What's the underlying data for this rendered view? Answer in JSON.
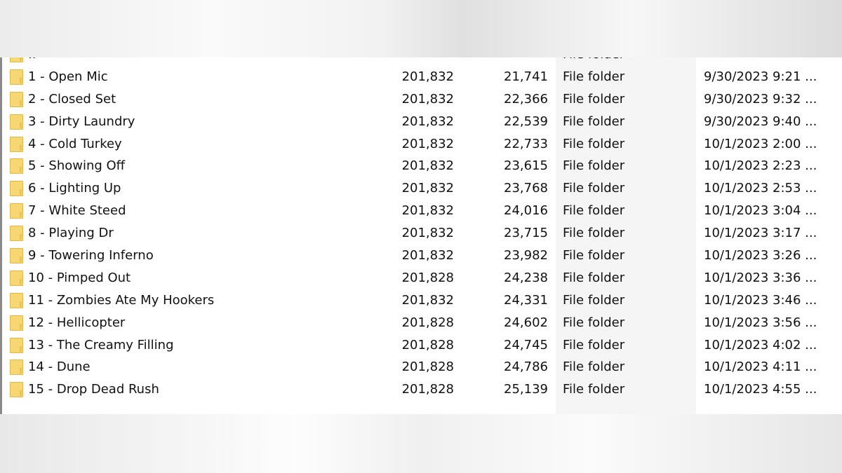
{
  "parent_row": {
    "name": "..",
    "type": "File folder"
  },
  "rows": [
    {
      "name": "1 - Open Mic",
      "c1": "201,832",
      "c2": "21,741",
      "type": "File folder",
      "date": "9/30/2023 9:21 ..."
    },
    {
      "name": "2 - Closed Set",
      "c1": "201,832",
      "c2": "22,366",
      "type": "File folder",
      "date": "9/30/2023 9:32 ..."
    },
    {
      "name": "3 - Dirty Laundry",
      "c1": "201,832",
      "c2": "22,539",
      "type": "File folder",
      "date": "9/30/2023 9:40 ..."
    },
    {
      "name": "4 - Cold Turkey",
      "c1": "201,832",
      "c2": "22,733",
      "type": "File folder",
      "date": "10/1/2023 2:00 ..."
    },
    {
      "name": "5 - Showing Off",
      "c1": "201,832",
      "c2": "23,615",
      "type": "File folder",
      "date": "10/1/2023 2:23 ..."
    },
    {
      "name": "6 - Lighting Up",
      "c1": "201,832",
      "c2": "23,768",
      "type": "File folder",
      "date": "10/1/2023 2:53 ..."
    },
    {
      "name": "7 - White Steed",
      "c1": "201,832",
      "c2": "24,016",
      "type": "File folder",
      "date": "10/1/2023 3:04 ..."
    },
    {
      "name": "8 - Playing Dr",
      "c1": "201,832",
      "c2": "23,715",
      "type": "File folder",
      "date": "10/1/2023 3:17 ..."
    },
    {
      "name": "9 - Towering Inferno",
      "c1": "201,832",
      "c2": "23,982",
      "type": "File folder",
      "date": "10/1/2023 3:26 ..."
    },
    {
      "name": "10 - Pimped Out",
      "c1": "201,828",
      "c2": "24,238",
      "type": "File folder",
      "date": "10/1/2023 3:36 ..."
    },
    {
      "name": "11 - Zombies Ate My Hookers",
      "c1": "201,832",
      "c2": "24,331",
      "type": "File folder",
      "date": "10/1/2023 3:46 ..."
    },
    {
      "name": "12 - Hellicopter",
      "c1": "201,828",
      "c2": "24,602",
      "type": "File folder",
      "date": "10/1/2023 3:56 ..."
    },
    {
      "name": "13 - The Creamy Filling",
      "c1": "201,828",
      "c2": "24,745",
      "type": "File folder",
      "date": "10/1/2023 4:02 ..."
    },
    {
      "name": "14 - Dune",
      "c1": "201,828",
      "c2": "24,786",
      "type": "File folder",
      "date": "10/1/2023 4:11 ..."
    },
    {
      "name": "15 - Drop Dead Rush",
      "c1": "201,828",
      "c2": "25,139",
      "type": "File folder",
      "date": "10/1/2023 4:55 ..."
    }
  ]
}
